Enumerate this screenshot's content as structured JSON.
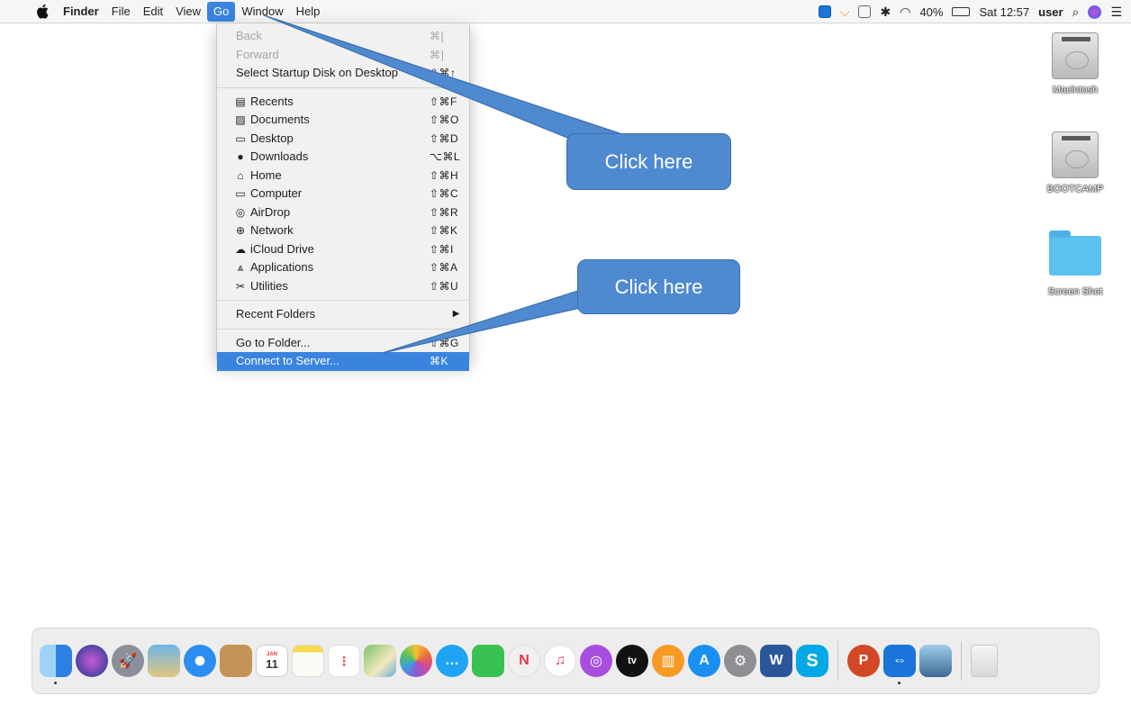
{
  "menubar": {
    "app_name": "Finder",
    "menus": [
      "File",
      "Edit",
      "View",
      "Go",
      "Window",
      "Help"
    ],
    "active_menu": "Go",
    "status": {
      "battery": "40%",
      "clock": "Sat 12:57",
      "user": "user"
    }
  },
  "go_menu": {
    "items": [
      {
        "label": "Back",
        "shortcut": "⌘[",
        "disabled": true
      },
      {
        "label": "Forward",
        "shortcut": "⌘]",
        "disabled": true
      },
      {
        "label": "Select Startup Disk on Desktop",
        "shortcut": "⇧⌘↑"
      },
      {
        "label": "Recents",
        "shortcut": "⇧⌘F",
        "icon": "recents-icon"
      },
      {
        "label": "Documents",
        "shortcut": "⇧⌘O",
        "icon": "documents-icon"
      },
      {
        "label": "Desktop",
        "shortcut": "⇧⌘D",
        "icon": "desktop-icon"
      },
      {
        "label": "Downloads",
        "shortcut": "⌥⌘L",
        "icon": "downloads-icon"
      },
      {
        "label": "Home",
        "shortcut": "⇧⌘H",
        "icon": "home-icon"
      },
      {
        "label": "Computer",
        "shortcut": "⇧⌘C",
        "icon": "computer-icon"
      },
      {
        "label": "AirDrop",
        "shortcut": "⇧⌘R",
        "icon": "airdrop-icon"
      },
      {
        "label": "Network",
        "shortcut": "⇧⌘K",
        "icon": "network-icon"
      },
      {
        "label": "iCloud Drive",
        "shortcut": "⇧⌘I",
        "icon": "icloud-icon"
      },
      {
        "label": "Applications",
        "shortcut": "⇧⌘A",
        "icon": "applications-icon"
      },
      {
        "label": "Utilities",
        "shortcut": "⇧⌘U",
        "icon": "utilities-icon"
      },
      {
        "label": "Recent Folders",
        "shortcut": "▶"
      },
      {
        "label": "Go to Folder...",
        "shortcut": "⇧⌘G"
      },
      {
        "label": "Connect to Server...",
        "shortcut": "⌘K",
        "highlighted": true
      }
    ]
  },
  "callouts": {
    "first": "Click here",
    "second": "Click here"
  },
  "desktop": {
    "icons": [
      {
        "label": "Macintosh",
        "kind": "drive"
      },
      {
        "label": "BOOTCAMP",
        "kind": "drive"
      },
      {
        "label": "Screen Shot",
        "kind": "folder"
      }
    ]
  },
  "dock": {
    "word_letter": "W",
    "skype_letter": "S",
    "powerpoint_letter": "P",
    "tv_label": "tv",
    "calendar_day": "11",
    "calendar_month": "JAN"
  },
  "colors": {
    "accent": "#3a84df",
    "callout": "#4f8ad0"
  }
}
